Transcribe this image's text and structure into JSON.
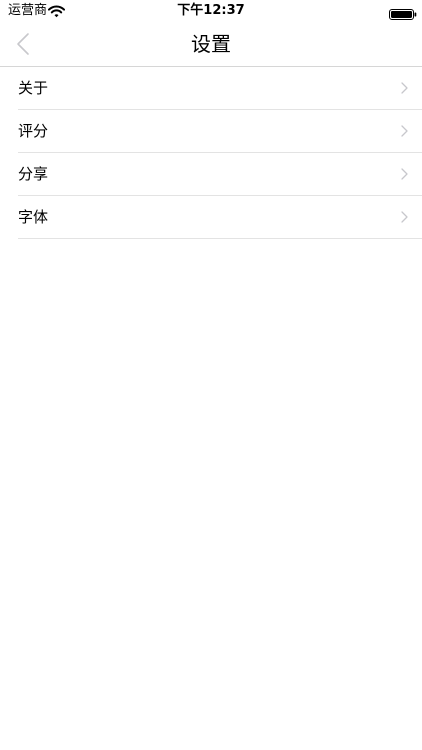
{
  "status_bar": {
    "carrier": "运营商",
    "time": "下午12:37",
    "wifi_icon": "wifi-icon",
    "battery_icon": "battery-icon"
  },
  "nav": {
    "title": "设置",
    "back_icon": "chevron-left-icon"
  },
  "settings": {
    "items": [
      {
        "label": "关于"
      },
      {
        "label": "评分"
      },
      {
        "label": "分享"
      },
      {
        "label": "字体"
      }
    ]
  },
  "colors": {
    "background": "#ffffff",
    "separator": "#e3e3e3",
    "chevron": "#c7c7cc",
    "back_icon": "#c8c8cc"
  }
}
